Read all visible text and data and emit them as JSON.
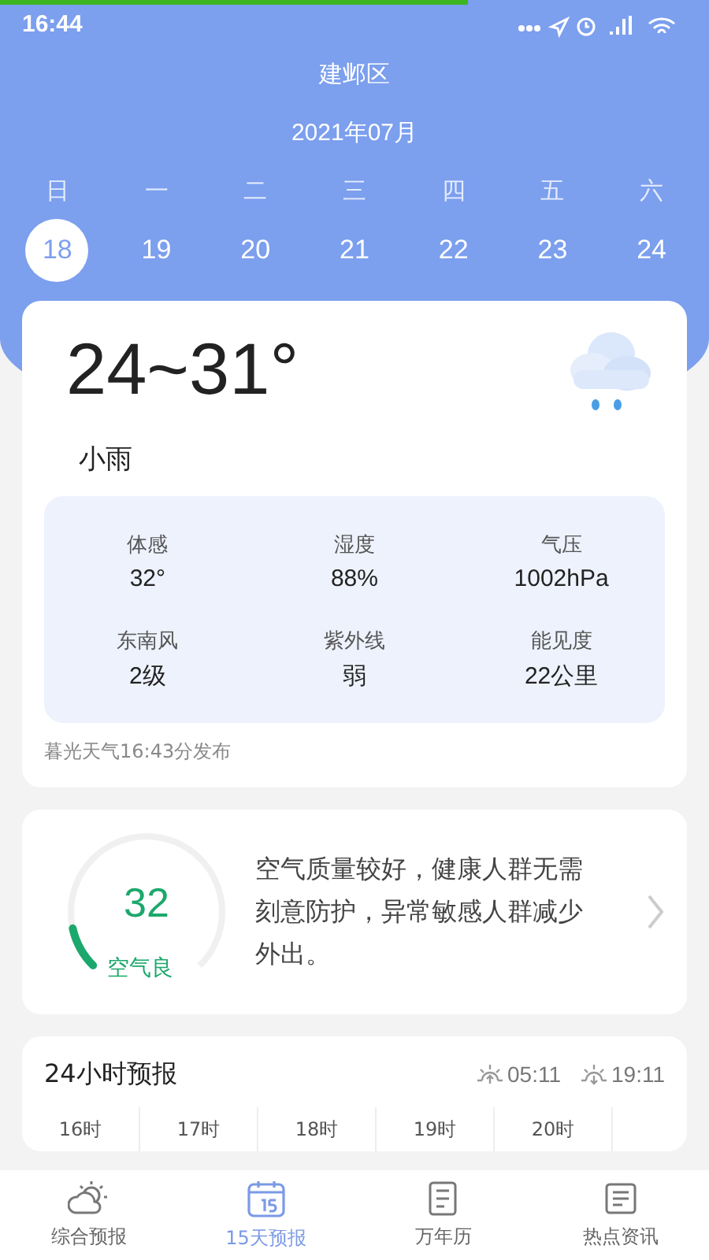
{
  "load_progress": {
    "level": 0.66
  },
  "status_bar": {
    "time": "16:44"
  },
  "header": {
    "district": "建邺区",
    "month": "2021年07月"
  },
  "week": {
    "weekdays": [
      "日",
      "一",
      "二",
      "三",
      "四",
      "五",
      "六"
    ],
    "days": [
      {
        "label": "18",
        "selected": true
      },
      {
        "label": "19",
        "selected": false
      },
      {
        "label": "20",
        "selected": false
      },
      {
        "label": "21",
        "selected": false
      },
      {
        "label": "22",
        "selected": false
      },
      {
        "label": "23",
        "selected": false
      },
      {
        "label": "24",
        "selected": false
      }
    ]
  },
  "today": {
    "temperature": "24~31°",
    "condition": "小雨",
    "details": [
      {
        "label": "体感",
        "value": "32°"
      },
      {
        "label": "湿度",
        "value": "88%"
      },
      {
        "label": "气压",
        "value": "1002hPa"
      },
      {
        "label": "东南风",
        "value": "2级"
      },
      {
        "label": "紫外线",
        "value": "弱"
      },
      {
        "label": "能见度",
        "value": "22公里"
      }
    ],
    "published": "暮光天气16:43分发布"
  },
  "air": {
    "index": "32",
    "grade": "空气良",
    "level": 0.12,
    "advice": "空气质量较好，健康人群无需刻意防护，异常敏感人群减少外出。"
  },
  "hourly": {
    "title": "24小时预报",
    "sunrise": "05:11",
    "sunset": "19:11",
    "hours": [
      "16时",
      "17时",
      "18时",
      "19时",
      "20时"
    ]
  },
  "tabs": [
    {
      "label": "综合预报",
      "selected": false,
      "kind": "weather"
    },
    {
      "label": "15天预报",
      "selected": true,
      "kind": "calendar"
    },
    {
      "label": "万年历",
      "selected": false,
      "kind": "almanac"
    },
    {
      "label": "热点资讯",
      "selected": false,
      "kind": "news"
    }
  ]
}
